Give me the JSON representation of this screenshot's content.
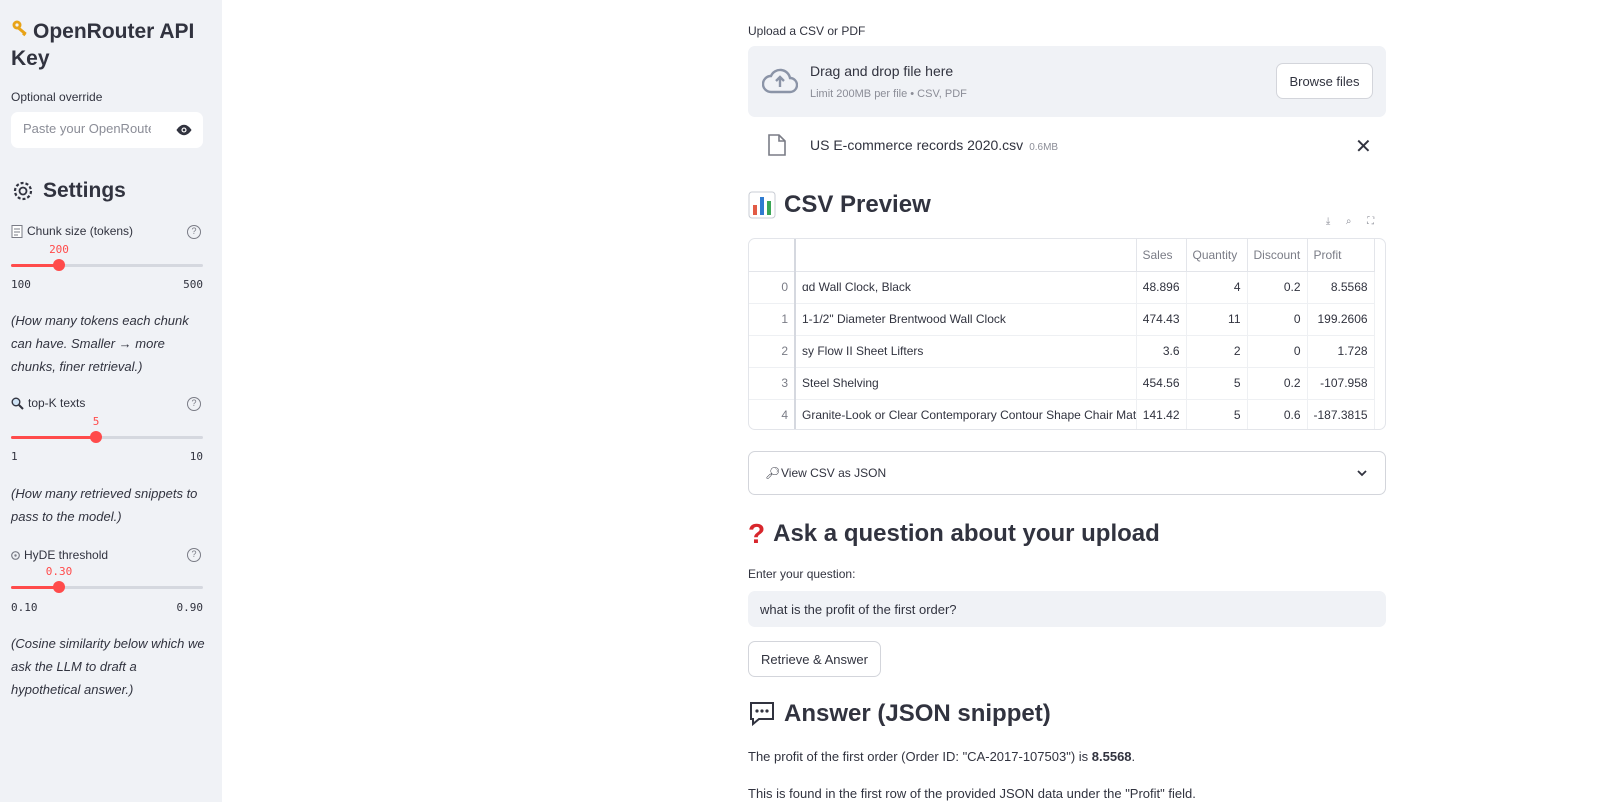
{
  "sidebar": {
    "api_title": "OpenRouter API Key",
    "override_label": "Optional override",
    "override_placeholder": "Paste your OpenRouter API key",
    "settings_title": "Settings",
    "chunk": {
      "label": "Chunk size (tokens)",
      "value": "200",
      "min": "100",
      "max": "500",
      "fraction": 0.25,
      "note": "(How many tokens each chunk can have. Smaller → more chunks, finer retrieval.)"
    },
    "topk": {
      "label": "top-K texts",
      "value": "5",
      "min": "1",
      "max": "10",
      "fraction": 0.444,
      "note": "(How many retrieved snippets to pass to the model.)"
    },
    "hyde": {
      "label": "HyDE threshold",
      "value": "0.30",
      "min": "0.10",
      "max": "0.90",
      "fraction": 0.25,
      "note": "(Cosine similarity below which we ask the LLM to draft a hypothetical answer.)"
    }
  },
  "upload": {
    "label": "Upload a CSV or PDF",
    "drag_text": "Drag and drop file here",
    "limit_text": "Limit 200MB per file • CSV, PDF",
    "browse_label": "Browse files",
    "file_name": "US E-commerce records 2020.csv",
    "file_size": "0.6MB"
  },
  "preview": {
    "title": "CSV Preview",
    "columns": [
      "",
      "Sales",
      "Quantity",
      "Discount",
      "Profit"
    ],
    "rows": [
      {
        "idx": "0",
        "name": "ɑd Wall Clock, Black",
        "sales": "48.896",
        "qty": "4",
        "disc": "0.2",
        "profit": "8.5568"
      },
      {
        "idx": "1",
        "name": "1-1/2\" Diameter Brentwood Wall Clock",
        "sales": "474.43",
        "qty": "11",
        "disc": "0",
        "profit": "199.2606"
      },
      {
        "idx": "2",
        "name": "sy Flow II Sheet Lifters",
        "sales": "3.6",
        "qty": "2",
        "disc": "0",
        "profit": "1.728"
      },
      {
        "idx": "3",
        "name": "Steel Shelving",
        "sales": "454.56",
        "qty": "5",
        "disc": "0.2",
        "profit": "-107.958"
      },
      {
        "idx": "4",
        "name": "Granite-Look or Clear Contemporary Contour Shape Chair Mats",
        "sales": "141.42",
        "qty": "5",
        "disc": "0.6",
        "profit": "-187.3815"
      }
    ],
    "json_expander": "View CSV as JSON"
  },
  "ask": {
    "title": "Ask a question about your upload",
    "question_label": "Enter your question:",
    "question_value": "what is the profit of the first order?",
    "button_label": "Retrieve & Answer"
  },
  "answer": {
    "title": "Answer (JSON snippet)",
    "line1_prefix": "The profit of the first order (Order ID: \"CA-2017-107503\") is ",
    "line1_value": "8.5568",
    "line1_suffix": ".",
    "line2": "This is found in the first row of the provided JSON data under the \"Profit\" field."
  },
  "colors": {
    "accent": "#ff4b4b",
    "sidebar_bg": "#f0f2f6",
    "text": "#31333f"
  }
}
